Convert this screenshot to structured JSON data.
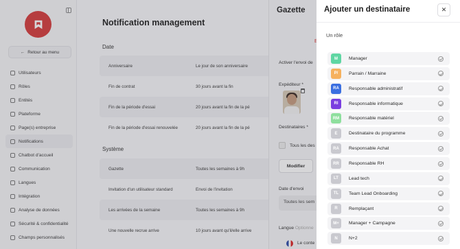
{
  "sidebar": {
    "back_label": "Retour au menu",
    "items": [
      {
        "label": "Utilisateurs",
        "icon": "users-icon"
      },
      {
        "label": "Rôles",
        "icon": "roles-icon"
      },
      {
        "label": "Entités",
        "icon": "entities-icon"
      },
      {
        "label": "Plateforme",
        "icon": "platform-icon"
      },
      {
        "label": "Page(s) entreprise",
        "icon": "company-page-icon"
      },
      {
        "label": "Notifications",
        "icon": "bell-icon"
      },
      {
        "label": "Chatbot d'accueil",
        "icon": "chatbot-icon"
      },
      {
        "label": "Communication",
        "icon": "communication-icon"
      },
      {
        "label": "Langues",
        "icon": "languages-icon"
      },
      {
        "label": "Intégration",
        "icon": "integration-icon"
      },
      {
        "label": "Analyse de données",
        "icon": "analytics-icon"
      },
      {
        "label": "Sécurité & confidentialité",
        "icon": "security-icon"
      },
      {
        "label": "Champs personnalisés",
        "icon": "custom-fields-icon"
      }
    ],
    "active_index": 5
  },
  "main": {
    "title": "Notification management",
    "date_section": {
      "title": "Date",
      "rows": [
        {
          "name": "Anniversaire",
          "value": "Le jour de son anniversaire"
        },
        {
          "name": "Fin de contrat",
          "value": "30 jours avant la fin"
        },
        {
          "name": "Fin de la période d'essai",
          "value": "20 jours avant la fin de la pé"
        },
        {
          "name": "Fin de la période d'essai renouvelée",
          "value": "20 jours avant la fin de la pé"
        }
      ]
    },
    "system_section": {
      "title": "Système",
      "rows": [
        {
          "name": "Gazette",
          "value": "Toutes les semaines à 9h"
        },
        {
          "name": "Invitation d'un utilisateur standard",
          "value": "Envoi de l'invitation"
        },
        {
          "name": "Les arrivées de la semaine",
          "value": "Toutes les semaines à 9h"
        },
        {
          "name": "Une nouvelle recrue arrive",
          "value": "10 jours avant qu'il/elle arrive"
        }
      ]
    }
  },
  "gazette": {
    "title": "Gazette",
    "activate_label": "Activer l'envoi de",
    "sender_label": "Expéditeur *",
    "recipients_label": "Destinataires *",
    "all_label": "Tous les des",
    "modify_button": "Modifier",
    "send_date_label": "Date d'envoi",
    "send_date_value": "Toutes les sem",
    "language_label": "Langue",
    "language_optional": "Optionne",
    "content_label": "Le conte",
    "red_marker": "E"
  },
  "panel": {
    "title": "Ajouter un destinataire",
    "close_icon": "close-icon",
    "section_label": "Un rôle",
    "roles": [
      {
        "badge": "M",
        "name": "Manager",
        "color": "#5fd6a3"
      },
      {
        "badge": "P/",
        "name": "Parrain / Marraine",
        "color": "#f6b15e"
      },
      {
        "badge": "RA",
        "name": "Responsable administratif",
        "color": "#3b6fe0"
      },
      {
        "badge": "RI",
        "name": "Responsable informatique",
        "color": "#7a3ee0"
      },
      {
        "badge": "RM",
        "name": "Responsable matériel",
        "color": "#8fdf9e"
      },
      {
        "badge": "E",
        "name": "Destinataire du programme",
        "color": "#c9c9cf"
      },
      {
        "badge": "RA",
        "name": "Responsable Achat",
        "color": "#c9c9cf"
      },
      {
        "badge": "RR",
        "name": "Responsable RH",
        "color": "#c9c9cf"
      },
      {
        "badge": "LT",
        "name": "Lead tech",
        "color": "#c9c9cf"
      },
      {
        "badge": "TL",
        "name": "Team Lead Onboarding",
        "color": "#c9c9cf"
      },
      {
        "badge": "R",
        "name": "Remplaçant",
        "color": "#c9c9cf"
      },
      {
        "badge": "M+",
        "name": "Manager + Campagne",
        "color": "#c9c9cf"
      },
      {
        "badge": "N",
        "name": "N+2",
        "color": "#c9c9cf"
      }
    ]
  }
}
